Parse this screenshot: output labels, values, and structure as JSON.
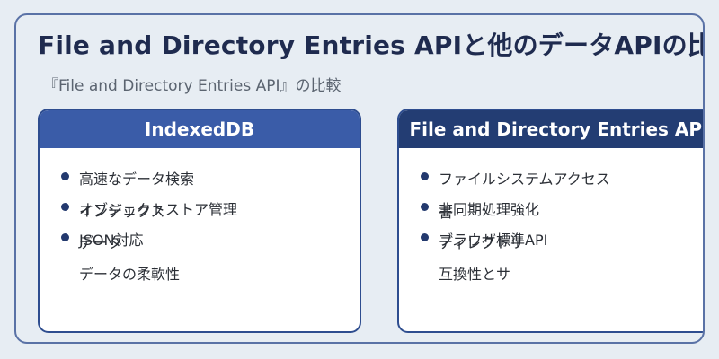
{
  "slide": {
    "title": "File and Directory Entries APIと他のデータAPIの比較",
    "subtitle": "『File and Directory Entries API』の比較"
  },
  "cards": [
    {
      "header": "IndexedDB",
      "items": [
        "高速なデータ検索",
        "オブジェクトストア管理",
        "JSON対応"
      ],
      "overflow_lines": [
        "インデックス",
        "データ",
        "データの柔軟性"
      ]
    },
    {
      "header": "File and Directory Entries API",
      "items": [
        "ファイルシステムアクセス",
        "非同期処理強化",
        "ブラウザ標準API"
      ],
      "overflow_lines": [
        "書",
        "ディレクトリ",
        "互換性とサ"
      ]
    }
  ],
  "colors": {
    "background": "#e7edf3",
    "left_header": "#3a5ca8",
    "right_header": "#233d73",
    "title": "#1f2b4f",
    "bullet": "#23396e"
  }
}
